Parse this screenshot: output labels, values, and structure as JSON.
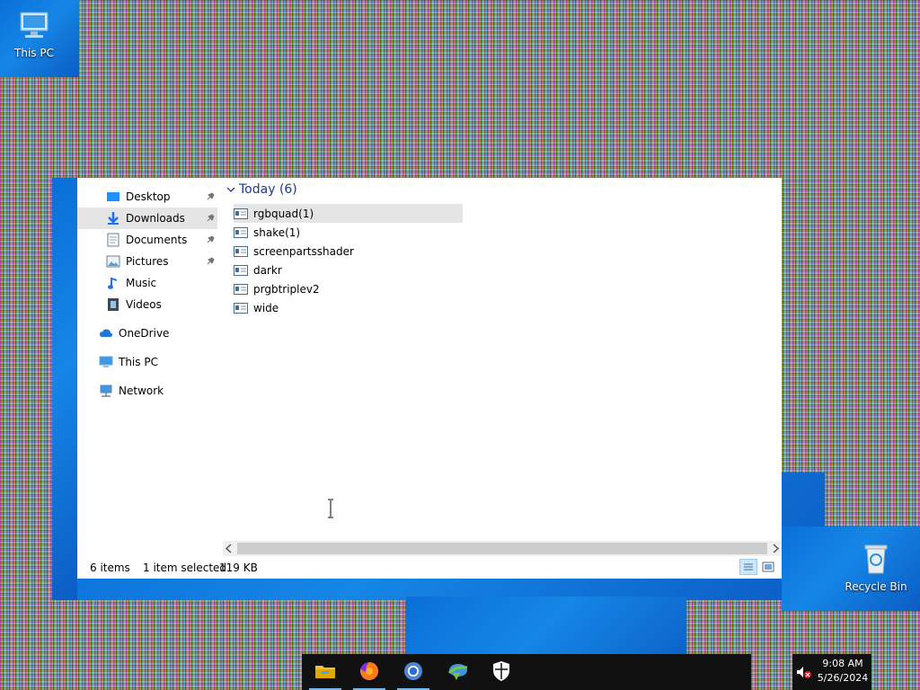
{
  "desktop": {
    "icons": [
      {
        "label": "This PC",
        "icon": "computer-icon"
      },
      {
        "label": "Recycle Bin",
        "icon": "recycle-bin-icon"
      }
    ]
  },
  "explorer": {
    "nav": {
      "quick_access": [
        {
          "label": "Desktop",
          "icon": "desktop-folder-icon",
          "pinned": true
        },
        {
          "label": "Downloads",
          "icon": "download-arrow-icon",
          "pinned": true,
          "selected": true
        },
        {
          "label": "Documents",
          "icon": "documents-icon",
          "pinned": true
        },
        {
          "label": "Pictures",
          "icon": "pictures-icon",
          "pinned": true
        },
        {
          "label": "Music",
          "icon": "music-note-icon"
        },
        {
          "label": "Videos",
          "icon": "videos-icon"
        }
      ],
      "locations": [
        {
          "label": "OneDrive",
          "icon": "cloud-icon"
        },
        {
          "label": "This PC",
          "icon": "computer-icon"
        },
        {
          "label": "Network",
          "icon": "network-icon"
        }
      ]
    },
    "group_header": "Today (6)",
    "files": [
      {
        "name": "rgbquad(1)",
        "selected": true
      },
      {
        "name": "shake(1)"
      },
      {
        "name": "screenpartsshader"
      },
      {
        "name": "darkr"
      },
      {
        "name": "prgbtriplev2"
      },
      {
        "name": "wide"
      }
    ],
    "status": {
      "item_count": "6 items",
      "selection": "1 item selected",
      "size": "119 KB"
    }
  },
  "taskbar": {
    "apps": [
      "file-explorer-icon",
      "firefox-icon",
      "chrome-icon",
      "internet-download-manager-icon",
      "windows-security-icon"
    ],
    "tray": {
      "time": "9:08 AM",
      "date": "5/26/2024",
      "volume_icon": "volume-muted-icon"
    }
  },
  "colors": {
    "accent": "#0078d7",
    "selection": "#e5e5e5",
    "taskbar": "#111111",
    "wallpaper": "#0a6fd8"
  }
}
